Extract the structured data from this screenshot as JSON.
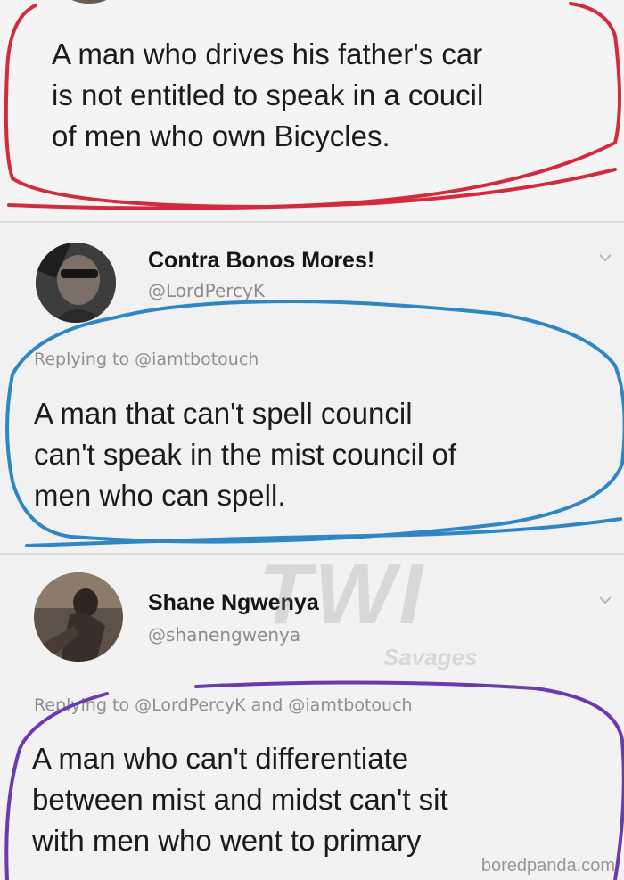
{
  "tweets": [
    {
      "display_name": "",
      "handle": "",
      "replying_to": "",
      "body_lines": [
        "A man who drives his father's car",
        "is not entitled to speak in a coucil",
        "of men who own Bicycles."
      ]
    },
    {
      "display_name": "Contra Bonos Mores!",
      "handle": "@LordPercyK",
      "replying_to": "Replying to @iamtbotouch",
      "body_lines": [
        "A man that can't spell council",
        "can't speak in the mist council of",
        "men who can spell."
      ]
    },
    {
      "display_name": "Shane Ngwenya",
      "handle": "@shanengwenya",
      "replying_to": "Replying to @LordPercyK and @iamtbotouch",
      "body_lines": [
        "A man who can't differentiate",
        "between mist and midst can't sit",
        "with men who went to primary"
      ]
    }
  ],
  "watermark": {
    "logo": "TWI",
    "sub": "Savages"
  },
  "credit": "boredpanda.com",
  "colors": {
    "annotation_red": "#d42b3c",
    "annotation_blue": "#2f86c4",
    "annotation_purple": "#6a3bb0"
  },
  "icons": {
    "more": "chevron-down-icon"
  }
}
